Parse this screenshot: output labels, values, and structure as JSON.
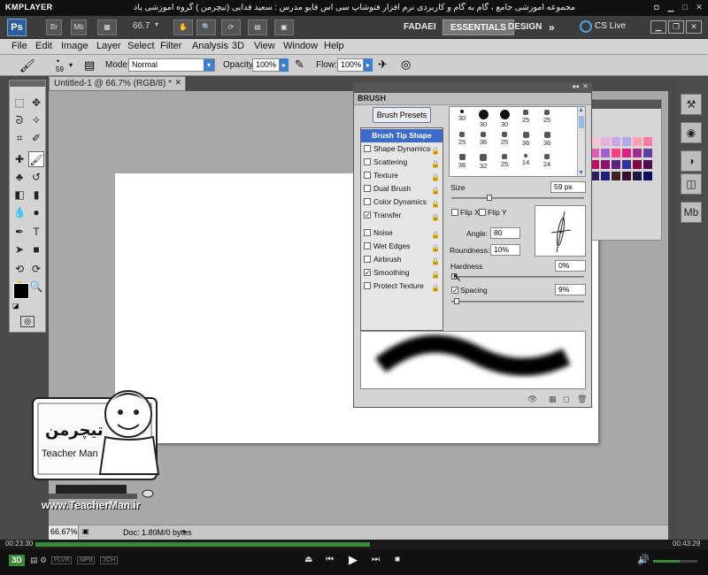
{
  "player": {
    "logo": "KMPLAYER",
    "title": "مجموعه آموزشی جامع ، گام به گام و کاربردی نرم افزار فتوشاپ سی اس فایو  مدرس : سعید فدایی (تیچرمن ) گروه آموزشی پادشاه گرافیست ها",
    "time_elapsed": "00:23:30",
    "time_total": "00:43:29",
    "badges": [
      "3D",
      "FLVR",
      "MP8",
      "2CH"
    ],
    "progress": 0.54,
    "volume": 0.6
  },
  "appbar": {
    "ps_logo": "Ps",
    "br_label": "Br",
    "mb_label": "Mb",
    "zoom": "66.7",
    "workspaces": [
      "FADAEI",
      "ESSENTIALS",
      "DESIGN"
    ],
    "active_workspace": "ESSENTIALS",
    "more": "»",
    "cs_live": "CS Live"
  },
  "menu": [
    "File",
    "Edit",
    "Image",
    "Layer",
    "Select",
    "Filter",
    "Analysis",
    "3D",
    "View",
    "Window",
    "Help"
  ],
  "options": {
    "brush_size": "59",
    "mode_label": "Mode:",
    "mode_value": "Normal",
    "opacity_label": "Opacity:",
    "opacity_value": "100%",
    "flow_label": "Flow:",
    "flow_value": "100%"
  },
  "document": {
    "tab_title": "Untitled-1 @ 66.7% (RGB/8) *",
    "zoom_status": "66.67%",
    "doc_info": "Doc: 1.80M/0 bytes"
  },
  "brush_panel": {
    "title": "BRUSH",
    "presets_button": "Brush Presets",
    "options": [
      {
        "label": "Brush Tip Shape",
        "checked": null,
        "highlighted": true
      },
      {
        "label": "Shape Dynamics",
        "checked": false
      },
      {
        "label": "Scattering",
        "checked": false
      },
      {
        "label": "Texture",
        "checked": false
      },
      {
        "label": "Dual Brush",
        "checked": false
      },
      {
        "label": "Color Dynamics",
        "checked": false
      },
      {
        "label": "Transfer",
        "checked": true
      },
      {
        "label": "Noise",
        "checked": false
      },
      {
        "label": "Wet Edges",
        "checked": false
      },
      {
        "label": "Airbrush",
        "checked": false
      },
      {
        "label": "Smoothing",
        "checked": true
      },
      {
        "label": "Protect Texture",
        "checked": false
      }
    ],
    "tips": [
      "30",
      "30",
      "30",
      "25",
      "25",
      "25",
      "36",
      "25",
      "36",
      "36",
      "36",
      "32",
      "25",
      "14",
      "24"
    ],
    "size_label": "Size",
    "size_value": "59 px",
    "flip_x": "Flip X",
    "flip_y": "Flip Y",
    "angle_label": "Angle:",
    "angle_value": "80",
    "roundness_label": "Roundness:",
    "roundness_value": "10%",
    "hardness_label": "Hardness",
    "hardness_value": "0%",
    "spacing_label": "Spacing",
    "spacing_value": "9%",
    "spacing_checked": true
  },
  "watermark": {
    "site": "www.TeacherMan.ir",
    "logo_text": "Teacher Man"
  },
  "colors": {
    "accent": "#3d6cc8",
    "workspace_bg": "#4a4a4a",
    "doc_bg": "#a9a9a9"
  }
}
